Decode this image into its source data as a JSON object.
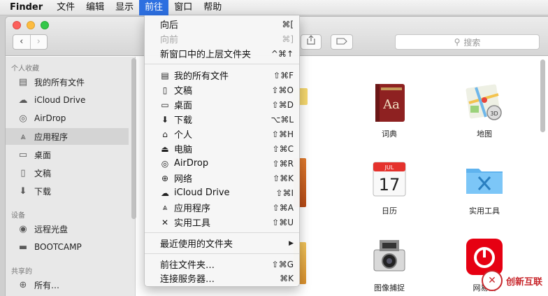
{
  "menubar": {
    "app": "Finder",
    "items": [
      "文件",
      "编辑",
      "显示",
      "前往",
      "窗口",
      "帮助"
    ],
    "active": "前往"
  },
  "toolbar": {
    "back": "‹",
    "forward": "›",
    "search_placeholder": "搜索"
  },
  "sidebar": {
    "sections": [
      {
        "title": "个人收藏",
        "items": [
          {
            "label": "我的所有文件",
            "icon": "all-files-icon"
          },
          {
            "label": "iCloud Drive",
            "icon": "cloud-icon"
          },
          {
            "label": "AirDrop",
            "icon": "airdrop-icon"
          },
          {
            "label": "应用程序",
            "icon": "applications-icon",
            "selected": true
          },
          {
            "label": "桌面",
            "icon": "desktop-icon"
          },
          {
            "label": "文稿",
            "icon": "documents-icon"
          },
          {
            "label": "下载",
            "icon": "download-icon"
          }
        ]
      },
      {
        "title": "设备",
        "items": [
          {
            "label": "远程光盘",
            "icon": "disc-icon"
          },
          {
            "label": "BOOTCAMP",
            "icon": "drive-icon"
          }
        ]
      },
      {
        "title": "共享的",
        "items": [
          {
            "label": "所有…",
            "icon": "network-icon"
          }
        ]
      }
    ]
  },
  "apps": [
    {
      "name": "词典",
      "icon": "dictionary-icon"
    },
    {
      "name": "地图",
      "icon": "maps-icon"
    },
    {
      "name": "日历",
      "icon": "calendar-icon",
      "month": "JUL",
      "day": "17"
    },
    {
      "name": "实用工具",
      "icon": "utilities-folder-icon"
    },
    {
      "name": "图像捕捉",
      "icon": "image-capture-icon"
    },
    {
      "name": "网易云",
      "icon": "netease-music-icon"
    }
  ],
  "go_menu": {
    "items": [
      {
        "label": "向后",
        "shortcut": "⌘[",
        "enabled": true
      },
      {
        "label": "向前",
        "shortcut": "⌘]",
        "enabled": false
      },
      {
        "label": "新窗口中的上层文件夹",
        "shortcut": "^⌘↑",
        "enabled": true
      },
      {
        "label": "我的所有文件",
        "shortcut": "⇧⌘F",
        "icon": "all-files-icon"
      },
      {
        "label": "文稿",
        "shortcut": "⇧⌘O",
        "icon": "documents-icon"
      },
      {
        "label": "桌面",
        "shortcut": "⇧⌘D",
        "icon": "desktop-icon"
      },
      {
        "label": "下载",
        "shortcut": "⌥⌘L",
        "icon": "download-icon"
      },
      {
        "label": "个人",
        "shortcut": "⇧⌘H",
        "icon": "home-icon"
      },
      {
        "label": "电脑",
        "shortcut": "⇧⌘C",
        "icon": "computer-icon"
      },
      {
        "label": "AirDrop",
        "shortcut": "⇧⌘R",
        "icon": "airdrop-icon"
      },
      {
        "label": "网络",
        "shortcut": "⇧⌘K",
        "icon": "network-icon"
      },
      {
        "label": "iCloud Drive",
        "shortcut": "⇧⌘I",
        "icon": "cloud-icon"
      },
      {
        "label": "应用程序",
        "shortcut": "⇧⌘A",
        "icon": "applications-icon"
      },
      {
        "label": "实用工具",
        "shortcut": "⇧⌘U",
        "icon": "utilities-icon"
      },
      {
        "label": "最近使用的文件夹",
        "shortcut": "▶"
      },
      {
        "label": "前往文件夹…",
        "shortcut": "⇧⌘G"
      },
      {
        "label": "连接服务器…",
        "shortcut": "⌘K"
      }
    ]
  },
  "watermark": {
    "text": "创新互联"
  }
}
